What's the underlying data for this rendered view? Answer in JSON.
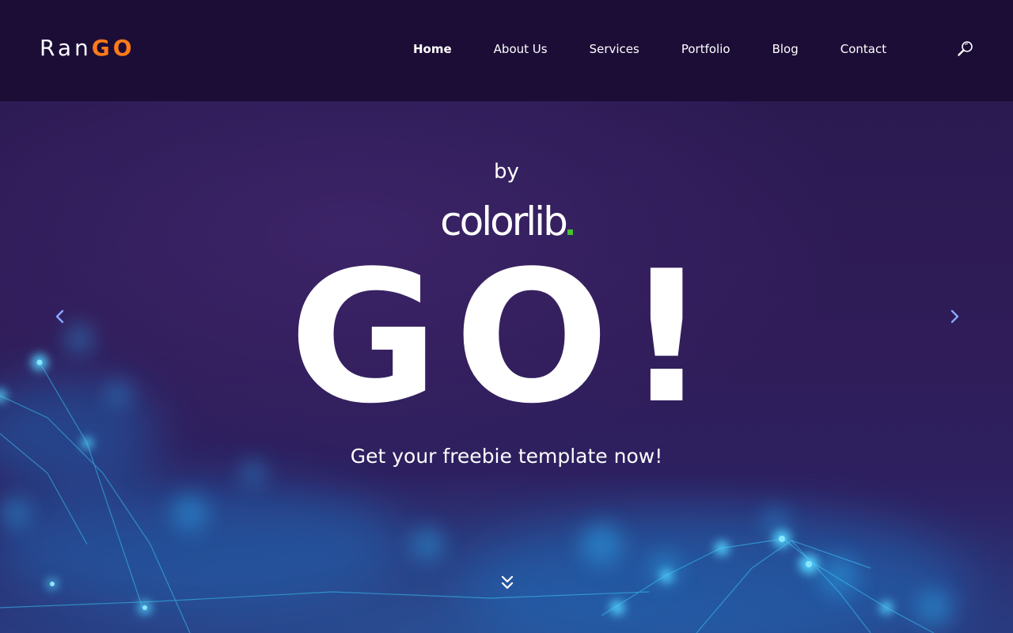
{
  "header": {
    "logo": {
      "part1": "Ran",
      "part2": "GO"
    },
    "nav": [
      {
        "label": "Home",
        "active": true
      },
      {
        "label": "About Us"
      },
      {
        "label": "Services"
      },
      {
        "label": "Portfolio"
      },
      {
        "label": "Blog"
      },
      {
        "label": "Contact"
      }
    ],
    "search_icon": "search-icon"
  },
  "hero": {
    "by": "by",
    "brand": "colorlib",
    "big": "GO!",
    "tagline": "Get your freebie template now!",
    "prev_icon": "chevron-left-icon",
    "next_icon": "chevron-right-icon",
    "scroll_icon": "double-chevron-down-icon"
  },
  "colors": {
    "header_bg": "#1c0d37",
    "hero_bg": "#2f1c58",
    "accent": "#ff7a1a",
    "brand_dot": "#43c22b",
    "text": "#ffffff",
    "glow": "#27b4f0"
  }
}
